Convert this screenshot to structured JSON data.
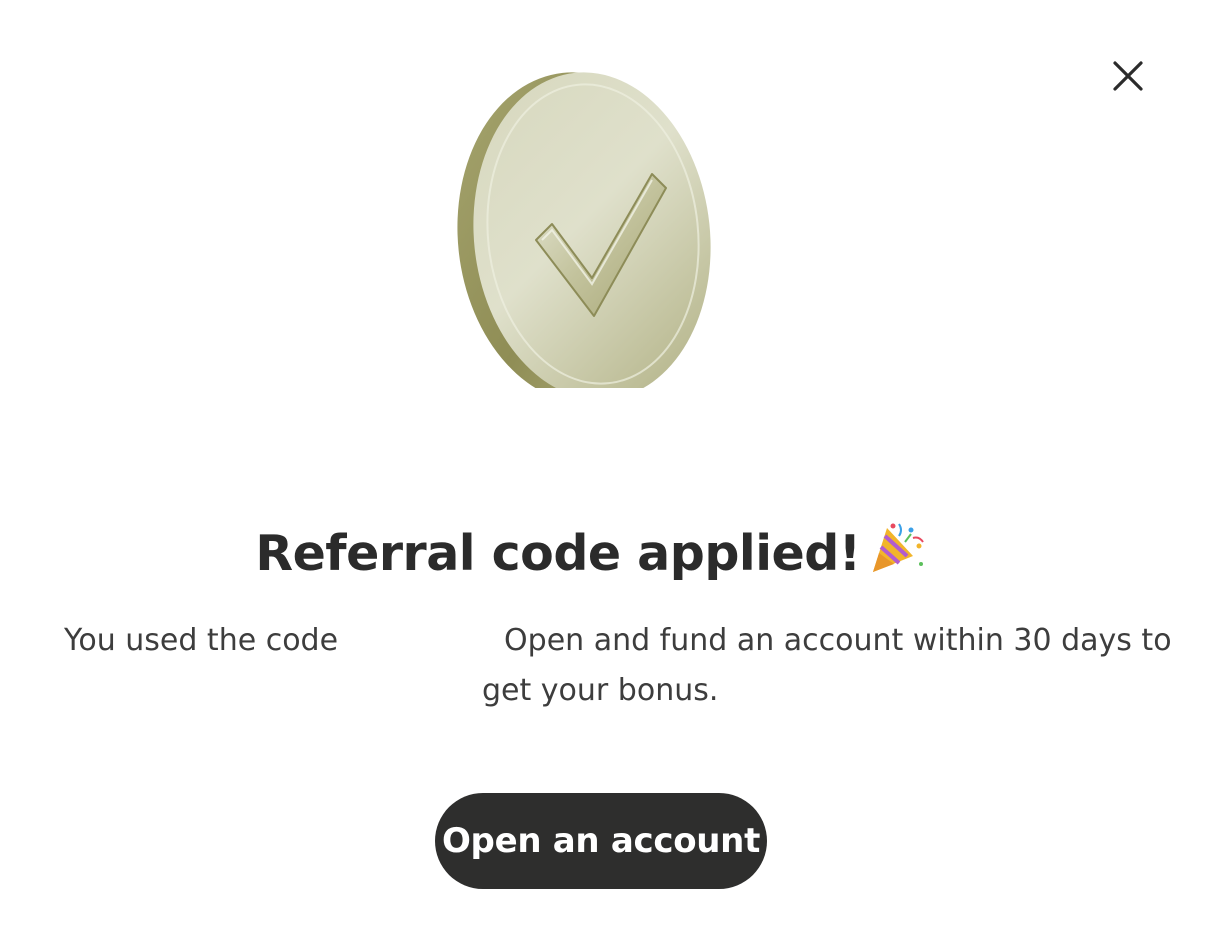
{
  "dialog": {
    "title": "Referral code applied!",
    "title_emoji_icon": "party-popper-icon",
    "message_part1": "You used the code",
    "message_part2": "Open and fund an account within 30 days to",
    "message_part3": "get your bonus.",
    "cta_label": "Open an account",
    "close_icon": "close-icon",
    "hero_icon": "checkmark-coin-icon"
  },
  "colors": {
    "text": "#2b2b2b",
    "button_bg": "#2e2e2d",
    "button_text": "#ffffff",
    "coin": "#c9c9a6"
  }
}
